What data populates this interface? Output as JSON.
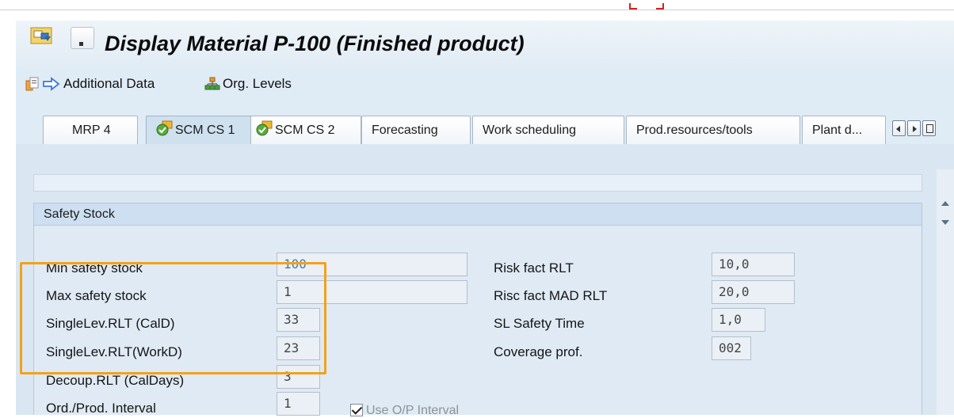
{
  "title": "Display Material P-100 (Finished product)",
  "toolbar": {
    "additional_data": "Additional Data",
    "org_levels": "Org. Levels"
  },
  "tabs": [
    {
      "label": "MRP 4"
    },
    {
      "label": "SCM CS 1",
      "active": true,
      "checked": true
    },
    {
      "label": "SCM CS 2",
      "checked": true
    },
    {
      "label": "Forecasting"
    },
    {
      "label": "Work scheduling"
    },
    {
      "label": "Prod.resources/tools"
    },
    {
      "label": "Plant d..."
    }
  ],
  "group": {
    "title": "Safety Stock",
    "left_fields": [
      {
        "label": "Min safety stock",
        "value": "100"
      },
      {
        "label": "Max safety stock",
        "value": "1"
      },
      {
        "label": "SingleLev.RLT (CalD)",
        "value": "33"
      },
      {
        "label": "SingleLev.RLT(WorkD)",
        "value": "23"
      },
      {
        "label": "Decoup.RLT (CalDays)",
        "value": "3"
      },
      {
        "label": "Ord./Prod. Interval",
        "value": "1"
      }
    ],
    "right_fields": [
      {
        "label": "Risk fact RLT",
        "value": "10,0"
      },
      {
        "label": "Risc fact MAD RLT",
        "value": "20,0"
      },
      {
        "label": "SL Safety Time",
        "value": "1,0"
      },
      {
        "label": "Coverage prof.",
        "value": "002"
      }
    ],
    "checkbox": {
      "label": "Use O/P Interval",
      "checked": true
    }
  },
  "colors": {
    "highlight": "#f2a11c",
    "background": "#dfebf5"
  }
}
